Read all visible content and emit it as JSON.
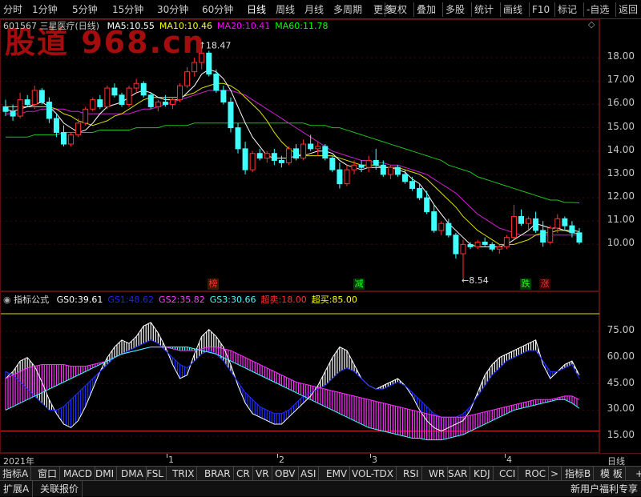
{
  "topbar": {
    "periods": [
      "分时",
      "1分钟",
      "5分钟",
      "15分钟",
      "30分钟",
      "60分钟",
      "日线",
      "周线",
      "月线",
      "多周期",
      "更多"
    ],
    "selected_period": "日线",
    "tools": [
      "复权",
      "叠加",
      "多股",
      "统计",
      "画线",
      "F10",
      "标记",
      "-自选",
      "返回"
    ]
  },
  "stock": {
    "code": "601567",
    "name": "三星医疗(日线)",
    "watermark": "股道 968.cn"
  },
  "ma": [
    {
      "label": "MA5:",
      "value": "10.55",
      "color": "#ffffff"
    },
    {
      "label": "MA10:",
      "value": "10.46",
      "color": "#ffff00"
    },
    {
      "label": "MA20:",
      "value": "10.41",
      "color": "#ff00ff"
    },
    {
      "label": "MA60:",
      "value": "11.78",
      "color": "#00ff00"
    }
  ],
  "price_axis": [
    "18.00",
    "17.00",
    "16.00",
    "15.00",
    "14.00",
    "13.00",
    "12.00",
    "11.00",
    "10.00"
  ],
  "annotations": {
    "high": "18.47",
    "low": "8.54"
  },
  "signals": [
    {
      "text": "榜",
      "color": "#ff3030",
      "bg": "#3a1a00"
    },
    {
      "text": "减",
      "color": "#20ff20",
      "bg": "#003a00"
    },
    {
      "text": "跌",
      "color": "#20ff20",
      "bg": "#003a00"
    },
    {
      "text": "涨",
      "color": "#ff3030",
      "bg": "#3a0000"
    }
  ],
  "indicator": {
    "title": "指标公式",
    "items": [
      {
        "label": "GS0:",
        "value": "39.61",
        "color": "#ffffff"
      },
      {
        "label": "GS1:",
        "value": "48.62",
        "color": "#2020ff"
      },
      {
        "label": "GS2:",
        "value": "35.82",
        "color": "#ff40ff"
      },
      {
        "label": "GS3:",
        "value": "30.66",
        "color": "#40ffff"
      },
      {
        "label": "超卖:",
        "value": "18.00",
        "color": "#ff3030"
      },
      {
        "label": "超买:",
        "value": "85.00",
        "color": "#ffff00"
      }
    ],
    "axis": [
      "75.00",
      "60.00",
      "45.00",
      "30.00",
      "15.00"
    ]
  },
  "xaxis": {
    "labels": [
      "2021年",
      "1",
      "2",
      "3",
      "4"
    ],
    "right": "日线"
  },
  "tabs": [
    "指标A",
    "窗口",
    "MACD",
    "DMI",
    "DMA",
    "FSL",
    "TRIX",
    "BRAR",
    "CR",
    "VR",
    "OBV",
    "ASI",
    "EMV",
    "VOL-TDX",
    "RSI",
    "WR",
    "SAR",
    "KDJ",
    "CCI",
    "ROC",
    ">",
    "指标B",
    "模 板",
    "+",
    "-"
  ],
  "bottom": {
    "left": [
      "扩展A",
      "关联报价"
    ],
    "right": "新用户福利专享"
  },
  "chart_data": {
    "type": "candlestick",
    "title": "601567 三星医疗(日线)",
    "ylim": [
      8.3,
      19.0
    ],
    "candles": [
      [
        15.9,
        16.2,
        15.5,
        15.7
      ],
      [
        15.7,
        16.0,
        15.3,
        15.5
      ],
      [
        15.5,
        16.5,
        15.4,
        16.2
      ],
      [
        16.2,
        16.4,
        15.9,
        16.0
      ],
      [
        16.0,
        16.8,
        15.8,
        16.6
      ],
      [
        16.6,
        16.7,
        16.0,
        16.1
      ],
      [
        16.1,
        16.3,
        15.2,
        15.4
      ],
      [
        15.4,
        15.6,
        14.6,
        14.8
      ],
      [
        14.8,
        15.1,
        14.2,
        14.3
      ],
      [
        14.3,
        14.8,
        14.2,
        14.7
      ],
      [
        14.7,
        15.4,
        14.6,
        15.2
      ],
      [
        15.2,
        15.9,
        15.1,
        15.8
      ],
      [
        15.8,
        16.3,
        15.7,
        16.2
      ],
      [
        16.2,
        16.4,
        15.8,
        15.9
      ],
      [
        15.9,
        16.8,
        15.8,
        16.7
      ],
      [
        16.7,
        16.9,
        16.3,
        16.4
      ],
      [
        16.4,
        16.5,
        15.9,
        16.0
      ],
      [
        16.0,
        16.8,
        15.9,
        16.7
      ],
      [
        16.7,
        17.1,
        16.5,
        16.9
      ],
      [
        16.9,
        17.0,
        16.3,
        16.4
      ],
      [
        16.4,
        16.5,
        15.8,
        15.9
      ],
      [
        15.9,
        16.2,
        15.7,
        16.1
      ],
      [
        16.1,
        16.4,
        15.9,
        16.0
      ],
      [
        16.0,
        16.3,
        15.8,
        16.2
      ],
      [
        16.2,
        16.9,
        16.1,
        16.8
      ],
      [
        16.8,
        17.6,
        16.7,
        17.4
      ],
      [
        17.4,
        18.0,
        17.2,
        17.8
      ],
      [
        17.8,
        18.47,
        17.5,
        18.2
      ],
      [
        18.2,
        18.3,
        17.2,
        17.3
      ],
      [
        17.3,
        17.5,
        16.5,
        16.6
      ],
      [
        16.6,
        16.8,
        16.0,
        16.1
      ],
      [
        16.1,
        16.3,
        14.8,
        15.0
      ],
      [
        15.0,
        15.2,
        13.9,
        14.1
      ],
      [
        14.1,
        14.4,
        13.0,
        13.2
      ],
      [
        13.2,
        14.0,
        13.1,
        13.9
      ],
      [
        13.9,
        14.1,
        13.6,
        13.7
      ],
      [
        13.7,
        14.0,
        13.5,
        13.9
      ],
      [
        13.9,
        14.1,
        13.4,
        13.6
      ],
      [
        13.6,
        13.8,
        13.3,
        13.5
      ],
      [
        13.5,
        14.2,
        13.4,
        14.1
      ],
      [
        14.1,
        14.3,
        13.6,
        13.7
      ],
      [
        13.7,
        14.5,
        13.6,
        14.3
      ],
      [
        14.3,
        14.7,
        14.0,
        14.1
      ],
      [
        14.1,
        14.4,
        13.8,
        14.2
      ],
      [
        14.2,
        14.3,
        13.6,
        13.7
      ],
      [
        13.7,
        13.8,
        13.1,
        13.2
      ],
      [
        13.2,
        13.5,
        12.4,
        12.6
      ],
      [
        12.6,
        13.4,
        12.5,
        13.2
      ],
      [
        13.2,
        13.6,
        13.0,
        13.4
      ],
      [
        13.4,
        13.6,
        13.1,
        13.3
      ],
      [
        13.3,
        13.8,
        13.1,
        13.6
      ],
      [
        13.6,
        14.1,
        13.2,
        13.4
      ],
      [
        13.4,
        13.6,
        12.9,
        13.0
      ],
      [
        13.0,
        13.4,
        12.8,
        13.3
      ],
      [
        13.3,
        13.4,
        12.9,
        13.0
      ],
      [
        13.0,
        13.2,
        12.6,
        12.7
      ],
      [
        12.7,
        12.9,
        12.3,
        12.4
      ],
      [
        12.4,
        12.6,
        11.9,
        12.0
      ],
      [
        12.0,
        12.3,
        11.3,
        11.4
      ],
      [
        11.4,
        11.7,
        10.5,
        10.6
      ],
      [
        10.6,
        11.0,
        10.4,
        10.9
      ],
      [
        10.9,
        11.1,
        10.3,
        10.4
      ],
      [
        10.4,
        10.5,
        9.4,
        9.6
      ],
      [
        9.6,
        10.2,
        8.54,
        10.0
      ],
      [
        10.0,
        10.1,
        9.8,
        9.9
      ],
      [
        9.9,
        10.2,
        9.8,
        10.1
      ],
      [
        10.1,
        10.3,
        9.9,
        10.0
      ],
      [
        10.0,
        10.1,
        9.7,
        9.8
      ],
      [
        9.8,
        10.0,
        9.6,
        9.9
      ],
      [
        9.9,
        10.4,
        9.8,
        10.3
      ],
      [
        10.3,
        11.7,
        10.2,
        11.2
      ],
      [
        11.2,
        11.5,
        10.8,
        10.9
      ],
      [
        10.9,
        11.2,
        10.6,
        11.1
      ],
      [
        11.1,
        11.4,
        10.5,
        10.6
      ],
      [
        10.6,
        11.0,
        9.9,
        10.1
      ],
      [
        10.1,
        10.8,
        10.0,
        10.7
      ],
      [
        10.7,
        11.3,
        10.5,
        11.1
      ],
      [
        11.1,
        11.2,
        10.6,
        10.8
      ],
      [
        10.8,
        11.0,
        10.3,
        10.5
      ],
      [
        10.5,
        10.7,
        10.0,
        10.1
      ]
    ],
    "ma5": [
      15.8,
      15.7,
      15.8,
      15.9,
      16.0,
      16.1,
      15.9,
      15.6,
      15.2,
      15.0,
      14.8,
      14.9,
      15.2,
      15.6,
      15.9,
      16.0,
      16.1,
      16.3,
      16.5,
      16.6,
      16.5,
      16.3,
      16.2,
      16.2,
      16.2,
      16.5,
      16.8,
      17.3,
      17.5,
      17.4,
      17.1,
      16.6,
      15.9,
      15.2,
      14.6,
      14.2,
      13.8,
      13.7,
      13.7,
      13.7,
      13.8,
      13.8,
      13.9,
      14.0,
      14.0,
      13.9,
      13.6,
      13.4,
      13.3,
      13.2,
      13.3,
      13.3,
      13.3,
      13.3,
      13.2,
      13.1,
      12.8,
      12.6,
      12.2,
      11.7,
      11.3,
      10.9,
      10.6,
      10.3,
      10.0,
      9.9,
      9.9,
      9.9,
      9.9,
      10.0,
      10.2,
      10.4,
      10.6,
      10.9,
      10.8,
      10.7,
      10.7,
      10.6,
      10.6,
      10.55
    ],
    "ma10": [
      15.9,
      15.9,
      15.9,
      15.9,
      15.9,
      15.9,
      15.9,
      15.8,
      15.6,
      15.5,
      15.3,
      15.2,
      15.1,
      15.2,
      15.3,
      15.5,
      15.6,
      15.8,
      16.0,
      16.2,
      16.3,
      16.3,
      16.3,
      16.3,
      16.3,
      16.4,
      16.5,
      16.7,
      16.8,
      16.9,
      16.9,
      16.8,
      16.6,
      16.3,
      16.0,
      15.7,
      15.3,
      14.8,
      14.4,
      14.1,
      13.9,
      13.8,
      13.8,
      13.8,
      13.8,
      13.8,
      13.7,
      13.6,
      13.5,
      13.4,
      13.4,
      13.4,
      13.3,
      13.3,
      13.3,
      13.2,
      13.1,
      13.0,
      12.8,
      12.5,
      12.2,
      11.9,
      11.6,
      11.2,
      10.9,
      10.6,
      10.4,
      10.2,
      10.0,
      10.0,
      10.0,
      10.1,
      10.2,
      10.4,
      10.5,
      10.5,
      10.6,
      10.6,
      10.5,
      10.46
    ],
    "ma20": [
      15.6,
      15.6,
      15.6,
      15.7,
      15.7,
      15.8,
      15.8,
      15.8,
      15.8,
      15.7,
      15.7,
      15.6,
      15.6,
      15.6,
      15.6,
      15.6,
      15.6,
      15.6,
      15.7,
      15.8,
      15.8,
      15.9,
      16.0,
      16.1,
      16.2,
      16.3,
      16.4,
      16.5,
      16.6,
      16.6,
      16.6,
      16.6,
      16.5,
      16.4,
      16.2,
      16.0,
      15.8,
      15.6,
      15.4,
      15.2,
      15.0,
      14.8,
      14.6,
      14.4,
      14.2,
      14.0,
      13.9,
      13.8,
      13.7,
      13.6,
      13.6,
      13.5,
      13.5,
      13.4,
      13.4,
      13.3,
      13.2,
      13.1,
      13.0,
      12.8,
      12.6,
      12.4,
      12.2,
      11.9,
      11.6,
      11.3,
      11.1,
      10.9,
      10.7,
      10.6,
      10.5,
      10.4,
      10.4,
      10.4,
      10.4,
      10.4,
      10.4,
      10.4,
      10.4,
      10.41
    ],
    "ma60": [
      14.6,
      14.6,
      14.6,
      14.6,
      14.7,
      14.7,
      14.7,
      14.7,
      14.8,
      14.8,
      14.8,
      14.8,
      14.8,
      14.9,
      14.9,
      14.9,
      14.9,
      14.9,
      15.0,
      15.0,
      15.0,
      15.0,
      15.1,
      15.1,
      15.1,
      15.1,
      15.2,
      15.2,
      15.2,
      15.2,
      15.2,
      15.2,
      15.2,
      15.2,
      15.2,
      15.2,
      15.2,
      15.2,
      15.2,
      15.2,
      15.2,
      15.2,
      15.1,
      15.1,
      15.1,
      15.0,
      15.0,
      14.9,
      14.8,
      14.7,
      14.6,
      14.5,
      14.4,
      14.3,
      14.2,
      14.1,
      14.0,
      13.9,
      13.8,
      13.7,
      13.6,
      13.4,
      13.3,
      13.2,
      13.1,
      12.9,
      12.8,
      12.7,
      12.6,
      12.5,
      12.4,
      12.3,
      12.2,
      12.1,
      12.0,
      11.9,
      11.9,
      11.8,
      11.8,
      11.78
    ],
    "ind_ylim": [
      6,
      90
    ],
    "gs0": [
      48,
      52,
      58,
      60,
      55,
      46,
      36,
      28,
      22,
      20,
      24,
      32,
      42,
      52,
      60,
      66,
      70,
      68,
      72,
      78,
      80,
      74,
      66,
      56,
      48,
      50,
      62,
      72,
      76,
      72,
      66,
      56,
      44,
      34,
      28,
      26,
      24,
      22,
      22,
      26,
      30,
      34,
      38,
      44,
      52,
      60,
      66,
      64,
      56,
      48,
      44,
      42,
      44,
      46,
      48,
      44,
      38,
      30,
      24,
      20,
      18,
      20,
      22,
      24,
      30,
      40,
      50,
      56,
      60,
      62,
      64,
      66,
      68,
      70,
      56,
      48,
      52,
      56,
      58,
      50
    ],
    "gs1": [
      52,
      50,
      46,
      42,
      38,
      34,
      30,
      30,
      32,
      36,
      40,
      44,
      48,
      52,
      56,
      60,
      62,
      64,
      66,
      68,
      70,
      68,
      64,
      60,
      56,
      54,
      58,
      62,
      64,
      62,
      58,
      52,
      46,
      40,
      36,
      32,
      30,
      28,
      28,
      30,
      34,
      38,
      40,
      42,
      44,
      48,
      52,
      54,
      52,
      48,
      44,
      42,
      42,
      44,
      46,
      44,
      40,
      36,
      32,
      28,
      26,
      26,
      26,
      28,
      32,
      38,
      44,
      50,
      54,
      58,
      60,
      62,
      64,
      64,
      58,
      52,
      52,
      54,
      56,
      48
    ],
    "gs2": [
      48,
      50,
      52,
      54,
      55,
      56,
      56,
      56,
      56,
      55,
      55,
      55,
      56,
      57,
      58,
      60,
      62,
      63,
      64,
      65,
      66,
      66,
      66,
      65,
      64,
      64,
      64,
      65,
      66,
      66,
      65,
      64,
      62,
      60,
      58,
      56,
      54,
      52,
      50,
      48,
      46,
      45,
      44,
      43,
      42,
      41,
      40,
      39,
      38,
      37,
      36,
      35,
      34,
      33,
      32,
      31,
      30,
      29,
      28,
      27,
      26,
      26,
      26,
      26,
      27,
      28,
      29,
      30,
      31,
      32,
      33,
      34,
      35,
      36,
      36,
      36,
      37,
      38,
      38,
      36
    ],
    "gs3": [
      30,
      32,
      34,
      36,
      38,
      40,
      42,
      44,
      46,
      48,
      50,
      52,
      54,
      56,
      58,
      60,
      62,
      63,
      64,
      65,
      66,
      66,
      66,
      66,
      66,
      66,
      65,
      64,
      63,
      62,
      60,
      58,
      56,
      54,
      52,
      50,
      48,
      46,
      44,
      42,
      40,
      38,
      36,
      34,
      32,
      30,
      28,
      26,
      24,
      22,
      20,
      19,
      18,
      17,
      16,
      15,
      14,
      14,
      13,
      13,
      13,
      14,
      15,
      16,
      18,
      20,
      22,
      24,
      26,
      28,
      30,
      31,
      32,
      33,
      34,
      35,
      36,
      36,
      34,
      31
    ],
    "oversold": 18,
    "overbought": 85
  }
}
